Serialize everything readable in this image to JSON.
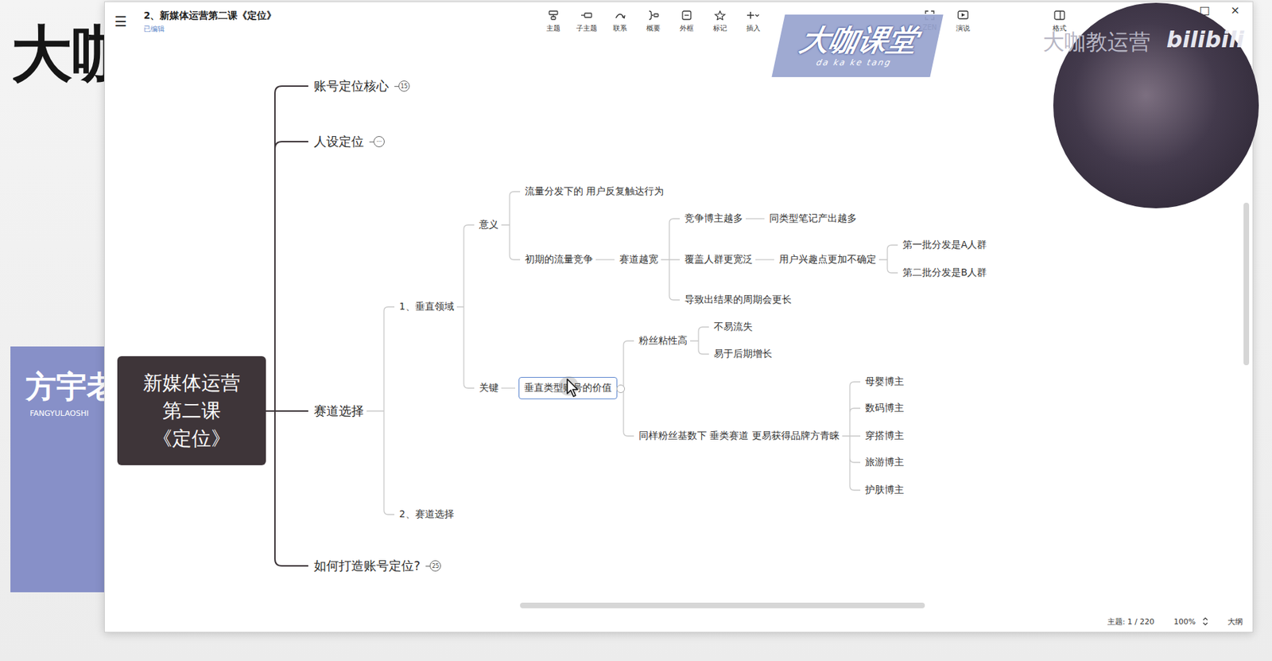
{
  "background": {
    "brand": "大咖",
    "panel": {
      "title": "方宇老",
      "subtitle": "FANGYULAOSHI"
    }
  },
  "window": {
    "menu": "☰",
    "title": "2、新媒体运营第二课《定位》",
    "status": "已编辑",
    "controls": [
      "□",
      "×"
    ]
  },
  "toolbar": [
    {
      "label": "主题"
    },
    {
      "label": "子主题"
    },
    {
      "label": "联系"
    },
    {
      "label": "概要"
    },
    {
      "label": "外框"
    },
    {
      "label": "标记"
    },
    {
      "label": "插入"
    }
  ],
  "view_tools": [
    {
      "label": "ZEN"
    },
    {
      "label": "演说"
    }
  ],
  "format_tool": {
    "label": "格式"
  },
  "watermark": {
    "logo": "大咖课堂",
    "logo_sub": "da ka ke tang",
    "channel": "大咖教运营",
    "site": "bilibili"
  },
  "map": {
    "root": {
      "lines": [
        "新媒体运营",
        "第二课",
        "《定位》"
      ],
      "children": [
        {
          "text": "账号定位核心",
          "badge": "15",
          "selected": false,
          "children": []
        },
        {
          "text": "人设定位",
          "badge": "···",
          "selected": false,
          "children": []
        },
        {
          "text": "赛道选择",
          "selected": false,
          "children": [
            {
              "text": "1、垂直领域",
              "selected": false,
              "children": [
                {
                  "text": "意义",
                  "selected": false,
                  "children": [
                    {
                      "text": "流量分发下的 用户反复触达行为",
                      "selected": false,
                      "children": []
                    },
                    {
                      "text": "初期的流量竞争",
                      "selected": false,
                      "children": [
                        {
                          "text": "赛道越宽",
                          "selected": false,
                          "children": [
                            {
                              "text": "竞争博主越多",
                              "selected": false,
                              "children": [
                                {
                                  "text": "同类型笔记产出越多",
                                  "selected": false,
                                  "children": []
                                }
                              ]
                            },
                            {
                              "text": "覆盖人群更宽泛",
                              "selected": false,
                              "children": [
                                {
                                  "text": "用户兴趣点更加不确定",
                                  "selected": false,
                                  "children": [
                                    {
                                      "text": "第一批分发是A人群",
                                      "selected": false,
                                      "children": []
                                    },
                                    {
                                      "text": "第二批分发是B人群",
                                      "selected": false,
                                      "children": []
                                    }
                                  ]
                                }
                              ]
                            },
                            {
                              "text": "导致出结果的周期会更长",
                              "selected": false,
                              "children": []
                            }
                          ]
                        }
                      ]
                    }
                  ]
                },
                {
                  "text": "关键",
                  "selected": false,
                  "children": [
                    {
                      "text": "垂直类型账号的价值",
                      "selected": true,
                      "children": [
                        {
                          "text": "粉丝粘性高",
                          "selected": false,
                          "children": [
                            {
                              "text": "不易流失",
                              "selected": false,
                              "children": []
                            },
                            {
                              "text": "易于后期增长",
                              "selected": false,
                              "children": []
                            }
                          ]
                        },
                        {
                          "text": "同样粉丝基数下 垂类赛道 更易获得品牌方青睐",
                          "selected": false,
                          "children": [
                            {
                              "text": "母婴博主",
                              "selected": false,
                              "children": []
                            },
                            {
                              "text": "数码博主",
                              "selected": false,
                              "children": []
                            },
                            {
                              "text": "穿搭博主",
                              "selected": false,
                              "children": []
                            },
                            {
                              "text": "旅游博主",
                              "selected": false,
                              "children": []
                            },
                            {
                              "text": "护肤博主",
                              "selected": false,
                              "children": []
                            }
                          ]
                        }
                      ]
                    }
                  ]
                }
              ]
            },
            {
              "text": "2、赛道选择",
              "selected": false,
              "children": []
            }
          ]
        },
        {
          "text": "如何打造账号定位?",
          "badge": "25",
          "selected": false,
          "children": []
        }
      ]
    }
  },
  "scrollbars": {
    "horizontal": {
      "start": 0.36,
      "size": 0.36
    },
    "vertical": {
      "start": 0.29,
      "size": 0.29
    }
  },
  "status_bar": {
    "topics": "主题: 1 / 220",
    "zoom": "100%",
    "outline": "大纲"
  }
}
